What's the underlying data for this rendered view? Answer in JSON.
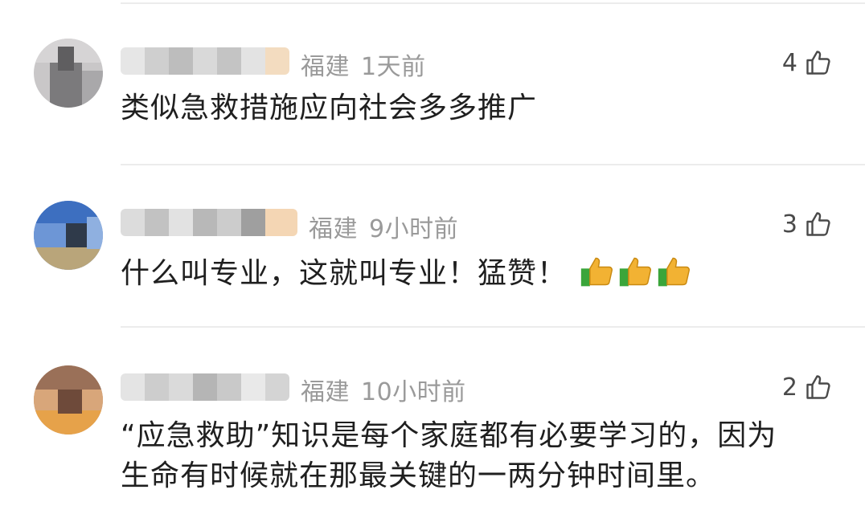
{
  "comments": [
    {
      "location": "福建",
      "time": "1天前",
      "likes": "4",
      "content": "类似急救措施应向社会多多推广"
    },
    {
      "location": "福建",
      "time": "9小时前",
      "likes": "3",
      "content": "什么叫专业，这就叫专业！猛赞！",
      "emoji": "thumbs-up-icon",
      "emoji_count": 3
    },
    {
      "location": "福建",
      "time": "10小时前",
      "likes": "2",
      "content_line1": "“应急救助”知识是每个家庭都有必要学习的，因为",
      "content_line2": "生命有时候就在那最关键的一两分钟时间里。"
    }
  ],
  "colors": {
    "meta": "#9a9a9a",
    "text": "#1f1f1f",
    "divider": "#ececec",
    "thumb_green": "#3aa53a",
    "thumb_yellow": "#f2b233"
  }
}
